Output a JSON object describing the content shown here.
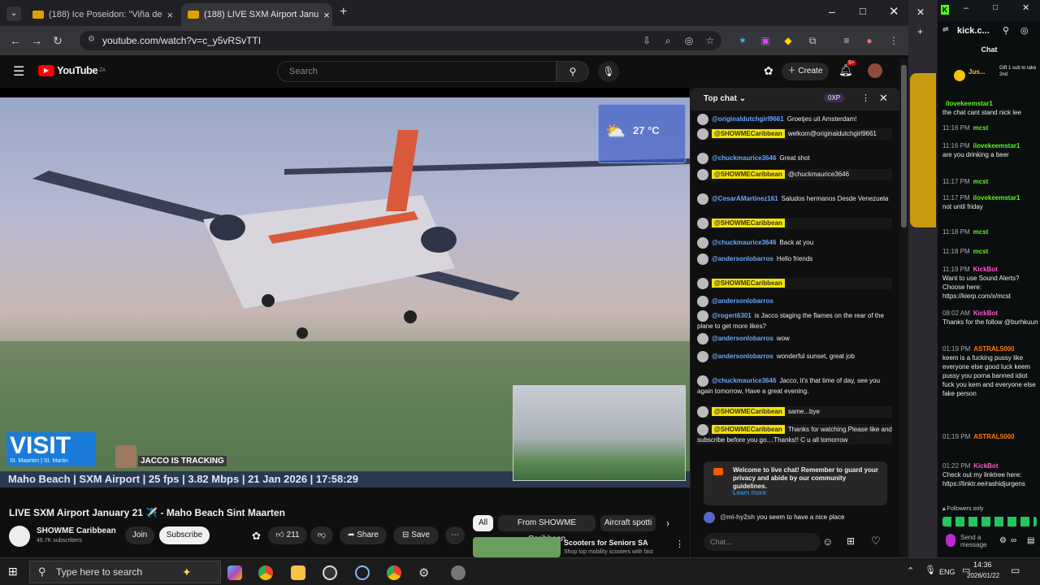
{
  "browser": {
    "tabs": [
      {
        "title": "(188) Ice Poseidon: \"Viña de",
        "active": false
      },
      {
        "title": "(188) LIVE SXM Airport Janu",
        "active": true
      }
    ],
    "url": "youtube.com/watch?v=c_y5vRSvTTI"
  },
  "youtube": {
    "logo": "YouTube",
    "logo_sup": "ZA",
    "search_placeholder": "Search",
    "create_label": "Create",
    "notif_count": "9+",
    "video": {
      "title": "LIVE SXM Airport January 21 ✈️ - Maho Beach Sint Maarten",
      "overlay_visit": "VISIT",
      "overlay_visit_sub": "St. Maarten | St. Martin",
      "overlay_tracking": "JACCO IS TRACKING",
      "overlay_info": "Maho Beach | SXM Airport | 25 fps | 3.82 Mbps | 21 Jan 2026 | 17:58:29",
      "weather_temp": "27 °C"
    },
    "channel": {
      "name": "SHOWME Caribbean",
      "subs": "46.7K subscribers"
    },
    "join_label": "Join",
    "subscribe_label": "Subscribe",
    "likes": "211",
    "share_label": "Share",
    "save_label": "Save",
    "chips": [
      "All",
      "From SHOWME Caribbean",
      "Aircraft spotti"
    ],
    "rec": {
      "title": "Scooters for Seniors SA",
      "sub": "Shop top mobility scooters with fast"
    }
  },
  "chat": {
    "header": "Top chat",
    "xp": "0XP",
    "input_placeholder": "Chat...",
    "messages": [
      {
        "user": "@originaldutchgirl9661",
        "text": "Groetjes uit Amsterdam!",
        "mod": false
      },
      {
        "user": "@SHOWMECaribbean",
        "text": "welkom@originaldutchgirl9661",
        "mod": true
      },
      {
        "user": "@chuckmaurice3646",
        "text": "Great shot",
        "mod": false
      },
      {
        "user": "@SHOWMECaribbean",
        "text": "@chuckmaurice3646",
        "mod": true
      },
      {
        "user": "@CesarAMartinez161",
        "text": "Saludos hermanos Desde Venezuela",
        "mod": false
      },
      {
        "user": "@SHOWMECaribbean",
        "text": "",
        "mod": true
      },
      {
        "user": "@chuckmaurice3646",
        "text": "Back at you",
        "mod": false
      },
      {
        "user": "@andersonlobarros",
        "text": "Hello friends",
        "mod": false
      },
      {
        "user": "@SHOWMECaribbean",
        "text": "",
        "mod": true
      },
      {
        "user": "@andersonlobarros",
        "text": "",
        "mod": false
      },
      {
        "user": "@rogert6301",
        "text": "is Jacco staging the flames on the rear of the plane to get more likes?",
        "mod": false
      },
      {
        "user": "@andersonlobarros",
        "text": "wow",
        "mod": false
      },
      {
        "user": "@andersonlobarros",
        "text": "wonderful sunset, great job",
        "mod": false
      },
      {
        "user": "@chuckmaurice3646",
        "text": "Jacco, it's that time of day, see you again tomorrow, Have a great evening.",
        "mod": false
      },
      {
        "user": "@SHOWMECaribbean",
        "text": "same...bye",
        "mod": true
      },
      {
        "user": "@SHOWMECaribbean",
        "text": "Thanks for watching.Please like and subscribe before you go....Thanks!! C u all tomorrow",
        "mod": true
      }
    ],
    "welcome": "Welcome to live chat! Remember to guard your privacy and abide by our community guidelines.",
    "learn_more": "Learn more",
    "last": {
      "user": "@ml-hy2sh",
      "text": "you seem to have a nice place"
    }
  },
  "kick": {
    "url": "kick.c...",
    "tab": "Chat",
    "pinned_user": "Jus...",
    "pinned_text": "Gift 1 sub to take 2nd",
    "messages": [
      {
        "time": "",
        "user": "ilovekeemstar1",
        "text": "the chat cant stand nick lee"
      },
      {
        "time": "11:16 PM",
        "user": "mcst",
        "text": ""
      },
      {
        "time": "11:16 PM",
        "user": "ilovekeemstar1",
        "text": "are you drinking a beer"
      },
      {
        "time": "11:17 PM",
        "user": "mcst",
        "text": ""
      },
      {
        "time": "11:17 PM",
        "user": "ilovekeemstar1",
        "text": "not until friday"
      },
      {
        "time": "11:18 PM",
        "user": "mcst",
        "text": ""
      },
      {
        "time": "11:18 PM",
        "user": "mcst",
        "text": ""
      },
      {
        "time": "11:19 PM",
        "user": "KickBot",
        "text": "Want to use Sound Alerts? Choose here: https://kierp.com/x/mcst"
      },
      {
        "time": "08:02 AM",
        "user": "KickBot",
        "text": "Thanks for the follow @burhkuun"
      },
      {
        "time": "01:19 PM",
        "user": "ASTRAL5000",
        "text": "keem is a fucking pussy like everyone else good luck keem pussy you porna banned idiot fuck you kem and everyone else fake person"
      },
      {
        "time": "01:19 PM",
        "user": "ASTRAL5000",
        "text": ""
      },
      {
        "time": "01:22 PM",
        "user": "KickBot",
        "text": "Check out my linktree here: https://linktr.ee/rashidjurgens"
      }
    ],
    "followers_only": "Followers only",
    "send_label": "Send a message"
  },
  "taskbar": {
    "search_placeholder": "Type here to search",
    "lang": "ENG",
    "time": "14:36",
    "date": "2026/01/22"
  }
}
